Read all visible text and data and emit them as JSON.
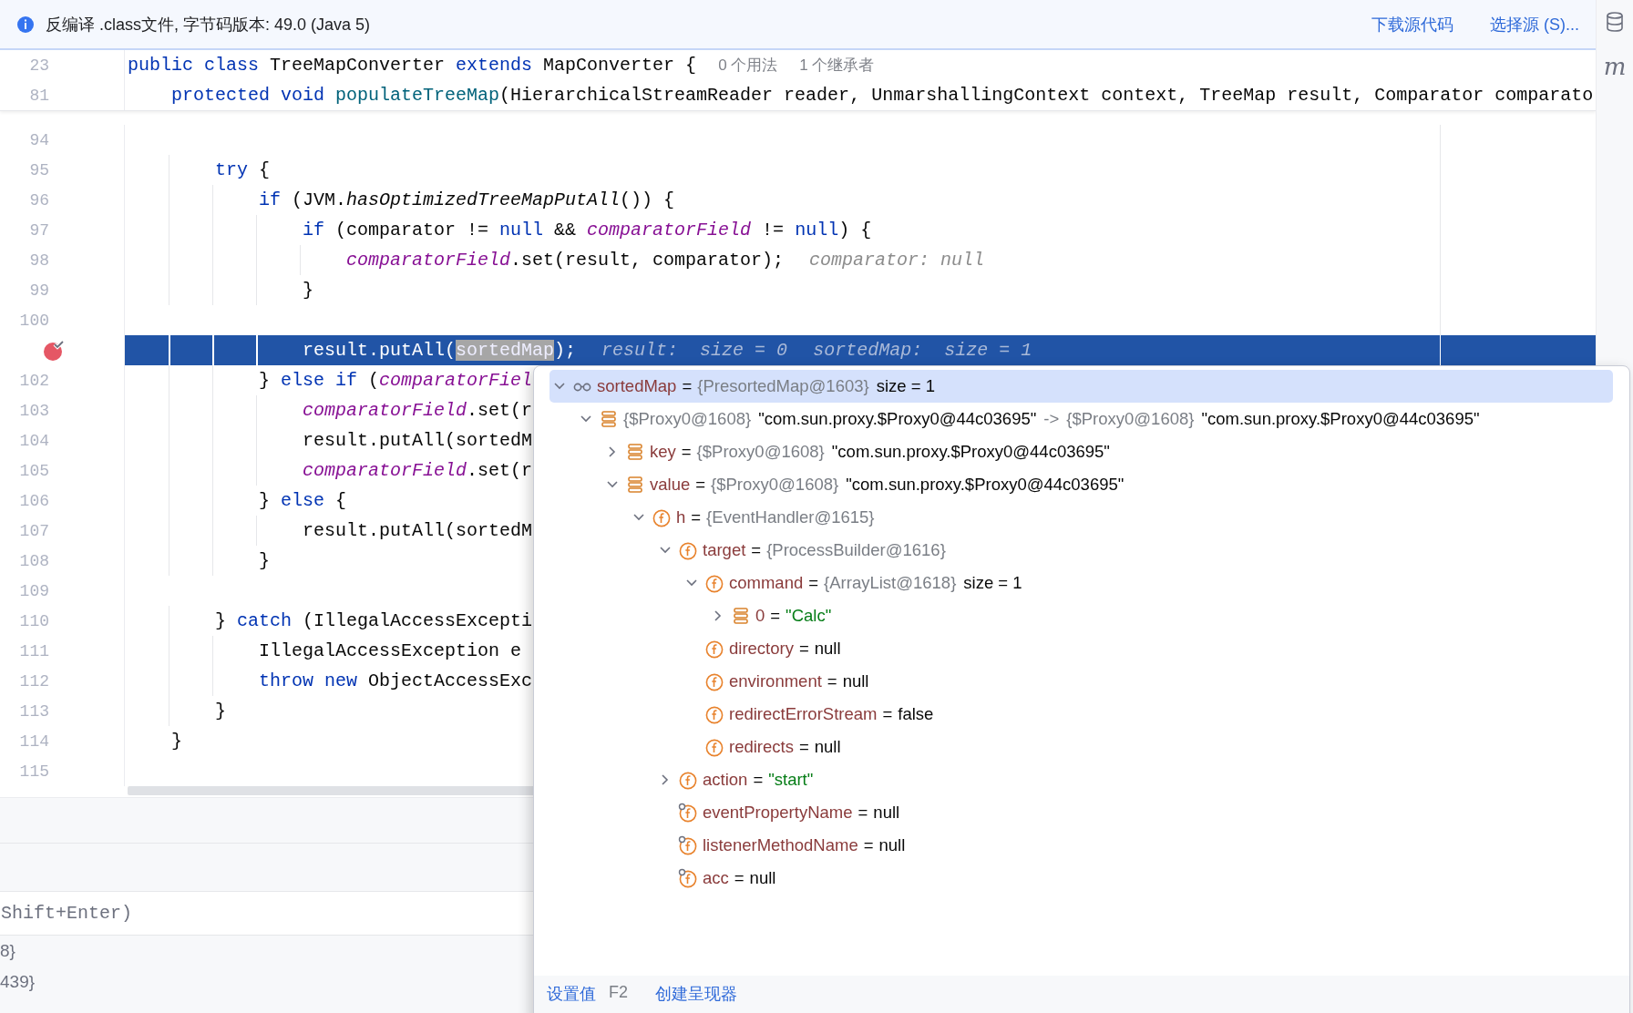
{
  "banner": {
    "message": "反编译 .class文件, 字节码版本: 49.0 (Java 5)",
    "links": [
      "下载源代码",
      "选择源 (S)..."
    ]
  },
  "side_tool_label": "m",
  "sticky_lines": [
    {
      "number": "23",
      "tokens": [
        {
          "kind": "kw",
          "s": "public class"
        },
        {
          "kind": "plain",
          "s": " TreeMapConverter "
        },
        {
          "kind": "kw",
          "s": "extends"
        },
        {
          "kind": "plain",
          "s": " MapConverter {"
        }
      ],
      "annotations": [
        "0 个用法",
        "1 个继承者"
      ]
    },
    {
      "number": "81",
      "tokens": [
        {
          "kind": "kw",
          "s": "    protected void "
        },
        {
          "kind": "decl",
          "s": "populateTreeMap"
        },
        {
          "kind": "plain",
          "s": "(HierarchicalStreamReader reader, UnmarshallingContext context, TreeMap result, Comparator comparato"
        }
      ]
    }
  ],
  "lines": [
    {
      "number": "94",
      "breakpoint": false,
      "current": false
    },
    {
      "number": "95",
      "breakpoint": false,
      "current": false,
      "tokens": [
        {
          "kind": "kw",
          "s": "        try"
        },
        {
          "kind": "plain",
          "s": " {"
        }
      ]
    },
    {
      "number": "96",
      "breakpoint": false,
      "current": false,
      "tokens": [
        {
          "kind": "kw",
          "s": "            if"
        },
        {
          "kind": "plain",
          "s": " (JVM."
        },
        {
          "kind": "static",
          "s": "hasOptimizedTreeMapPutAll"
        },
        {
          "kind": "plain",
          "s": "()) {"
        }
      ]
    },
    {
      "number": "97",
      "breakpoint": false,
      "current": false,
      "tokens": [
        {
          "kind": "kw",
          "s": "                if"
        },
        {
          "kind": "plain",
          "s": " (comparator != "
        },
        {
          "kind": "kw",
          "s": "null"
        },
        {
          "kind": "plain",
          "s": " && "
        },
        {
          "kind": "field",
          "s": "comparatorField"
        },
        {
          "kind": "plain",
          "s": " != "
        },
        {
          "kind": "kw",
          "s": "null"
        },
        {
          "kind": "plain",
          "s": ") {"
        }
      ]
    },
    {
      "number": "98",
      "breakpoint": false,
      "current": false,
      "tokens": [
        {
          "kind": "field",
          "s": "                    comparatorField"
        },
        {
          "kind": "plain",
          "s": ".set(result, comparator);"
        },
        {
          "kind": "hint",
          "s": "comparator: null"
        }
      ]
    },
    {
      "number": "99",
      "breakpoint": false,
      "current": false,
      "tokens": [
        {
          "kind": "plain",
          "s": "                }"
        }
      ]
    },
    {
      "number": "100",
      "breakpoint": false,
      "current": false
    },
    {
      "breakpoint": true,
      "current": true,
      "tokens": [
        {
          "kind": "plain",
          "s": "                result.putAll("
        },
        {
          "kind": "sel",
          "s": "sortedMap"
        },
        {
          "kind": "plain",
          "s": ");"
        },
        {
          "kind": "hint",
          "s": "result:  size = 0"
        },
        {
          "kind": "hint",
          "s": "sortedMap:  size = 1"
        }
      ]
    },
    {
      "number": "102",
      "breakpoint": false,
      "current": false,
      "tokens": [
        {
          "kind": "plain",
          "s": "            } "
        },
        {
          "kind": "kw",
          "s": "else if"
        },
        {
          "kind": "plain",
          "s": " ("
        },
        {
          "kind": "field",
          "s": "comparatorFiel"
        }
      ]
    },
    {
      "number": "103",
      "breakpoint": false,
      "current": false,
      "tokens": [
        {
          "kind": "field",
          "s": "                comparatorField"
        },
        {
          "kind": "plain",
          "s": ".set(r"
        }
      ]
    },
    {
      "number": "104",
      "breakpoint": false,
      "current": false,
      "tokens": [
        {
          "kind": "plain",
          "s": "                result.putAll(sortedM"
        }
      ]
    },
    {
      "number": "105",
      "breakpoint": false,
      "current": false,
      "tokens": [
        {
          "kind": "field",
          "s": "                comparatorField"
        },
        {
          "kind": "plain",
          "s": ".set(r"
        }
      ]
    },
    {
      "number": "106",
      "breakpoint": false,
      "current": false,
      "tokens": [
        {
          "kind": "plain",
          "s": "            } "
        },
        {
          "kind": "kw",
          "s": "else"
        },
        {
          "kind": "plain",
          "s": " {"
        }
      ]
    },
    {
      "number": "107",
      "breakpoint": false,
      "current": false,
      "tokens": [
        {
          "kind": "plain",
          "s": "                result.putAll(sortedM"
        }
      ]
    },
    {
      "number": "108",
      "breakpoint": false,
      "current": false,
      "tokens": [
        {
          "kind": "plain",
          "s": "            }"
        }
      ]
    },
    {
      "number": "109",
      "breakpoint": false,
      "current": false
    },
    {
      "number": "110",
      "breakpoint": false,
      "current": false,
      "tokens": [
        {
          "kind": "plain",
          "s": "        } "
        },
        {
          "kind": "kw",
          "s": "catch"
        },
        {
          "kind": "plain",
          "s": " (IllegalAccessExcepti"
        }
      ]
    },
    {
      "number": "111",
      "breakpoint": false,
      "current": false,
      "tokens": [
        {
          "kind": "plain",
          "s": "            IllegalAccessException e"
        }
      ]
    },
    {
      "number": "112",
      "breakpoint": false,
      "current": false,
      "tokens": [
        {
          "kind": "kw",
          "s": "            throw new"
        },
        {
          "kind": "plain",
          "s": " ObjectAccessExc"
        }
      ]
    },
    {
      "number": "113",
      "breakpoint": false,
      "current": false,
      "tokens": [
        {
          "kind": "plain",
          "s": "        }"
        }
      ]
    },
    {
      "number": "114",
      "breakpoint": false,
      "current": false,
      "tokens": [
        {
          "kind": "plain",
          "s": "    }"
        }
      ]
    },
    {
      "number": "115",
      "breakpoint": false,
      "current": false
    }
  ],
  "expression_field": {
    "placeholder": "Shift+Enter)"
  },
  "variable_fragments": [
    "8}",
    "439}"
  ],
  "popup": {
    "tree": [
      {
        "kind": "watch",
        "expanded": true,
        "selected": true,
        "parts": [
          {
            "kind": "name",
            "s": "sortedMap"
          },
          {
            "kind": "op",
            "s": "="
          },
          {
            "kind": "type",
            "s": "{PresortedMap@1603}"
          },
          {
            "kind": "plain",
            "s": "size = 1"
          }
        ],
        "children": [
          {
            "kind": "entry",
            "expanded": true,
            "selected": false,
            "parts": [
              {
                "kind": "type",
                "s": "{$Proxy0@1608}"
              },
              {
                "kind": "plain",
                "s": "\"com.sun.proxy.$Proxy0@44c03695\""
              },
              {
                "kind": "type",
                "s": "->"
              },
              {
                "kind": "type",
                "s": "{$Proxy0@1608}"
              },
              {
                "kind": "plain",
                "s": "\"com.sun.proxy.$Proxy0@44c03695\""
              }
            ],
            "children": [
              {
                "kind": "entry",
                "expanded": false,
                "selected": false,
                "parts": [
                  {
                    "kind": "name",
                    "s": "key"
                  },
                  {
                    "kind": "op",
                    "s": "="
                  },
                  {
                    "kind": "type",
                    "s": "{$Proxy0@1608}"
                  },
                  {
                    "kind": "plain",
                    "s": "\"com.sun.proxy.$Proxy0@44c03695\""
                  }
                ]
              },
              {
                "kind": "entry",
                "expanded": true,
                "selected": false,
                "parts": [
                  {
                    "kind": "name",
                    "s": "value"
                  },
                  {
                    "kind": "op",
                    "s": "="
                  },
                  {
                    "kind": "type",
                    "s": "{$Proxy0@1608}"
                  },
                  {
                    "kind": "plain",
                    "s": "\"com.sun.proxy.$Proxy0@44c03695\""
                  }
                ],
                "children": [
                  {
                    "kind": "field",
                    "expanded": true,
                    "selected": false,
                    "parts": [
                      {
                        "kind": "name",
                        "s": "h"
                      },
                      {
                        "kind": "op",
                        "s": "="
                      },
                      {
                        "kind": "type",
                        "s": "{EventHandler@1615}"
                      }
                    ],
                    "children": [
                      {
                        "kind": "field",
                        "expanded": true,
                        "selected": false,
                        "parts": [
                          {
                            "kind": "name",
                            "s": "target"
                          },
                          {
                            "kind": "op",
                            "s": "="
                          },
                          {
                            "kind": "type",
                            "s": "{ProcessBuilder@1616}"
                          }
                        ],
                        "children": [
                          {
                            "kind": "field",
                            "expanded": true,
                            "selected": false,
                            "parts": [
                              {
                                "kind": "name",
                                "s": "command"
                              },
                              {
                                "kind": "op",
                                "s": "="
                              },
                              {
                                "kind": "type",
                                "s": "{ArrayList@1618}"
                              },
                              {
                                "kind": "plain",
                                "s": "size = 1"
                              }
                            ],
                            "children": [
                              {
                                "kind": "entry",
                                "expanded": false,
                                "selected": false,
                                "parts": [
                                  {
                                    "kind": "name",
                                    "s": "0"
                                  },
                                  {
                                    "kind": "op",
                                    "s": "="
                                  },
                                  {
                                    "kind": "string",
                                    "s": "\"Calc\""
                                  }
                                ]
                              }
                            ]
                          },
                          {
                            "kind": "field",
                            "selected": false,
                            "parts": [
                              {
                                "kind": "name",
                                "s": "directory"
                              },
                              {
                                "kind": "op",
                                "s": "="
                              },
                              {
                                "kind": "plain",
                                "s": "null"
                              }
                            ]
                          },
                          {
                            "kind": "field",
                            "selected": false,
                            "parts": [
                              {
                                "kind": "name",
                                "s": "environment"
                              },
                              {
                                "kind": "op",
                                "s": "="
                              },
                              {
                                "kind": "plain",
                                "s": "null"
                              }
                            ]
                          },
                          {
                            "kind": "field",
                            "selected": false,
                            "parts": [
                              {
                                "kind": "name",
                                "s": "redirectErrorStream"
                              },
                              {
                                "kind": "op",
                                "s": "="
                              },
                              {
                                "kind": "plain",
                                "s": "false"
                              }
                            ]
                          },
                          {
                            "kind": "field",
                            "selected": false,
                            "parts": [
                              {
                                "kind": "name",
                                "s": "redirects"
                              },
                              {
                                "kind": "op",
                                "s": "="
                              },
                              {
                                "kind": "plain",
                                "s": "null"
                              }
                            ]
                          }
                        ]
                      },
                      {
                        "kind": "field",
                        "expanded": false,
                        "selected": false,
                        "parts": [
                          {
                            "kind": "name",
                            "s": "action"
                          },
                          {
                            "kind": "op",
                            "s": "="
                          },
                          {
                            "kind": "string",
                            "s": "\"start\""
                          }
                        ]
                      },
                      {
                        "kind": "marked_field",
                        "selected": false,
                        "parts": [
                          {
                            "kind": "name",
                            "s": "eventPropertyName"
                          },
                          {
                            "kind": "op",
                            "s": "="
                          },
                          {
                            "kind": "plain",
                            "s": "null"
                          }
                        ]
                      },
                      {
                        "kind": "marked_field",
                        "selected": false,
                        "parts": [
                          {
                            "kind": "name",
                            "s": "listenerMethodName"
                          },
                          {
                            "kind": "op",
                            "s": "="
                          },
                          {
                            "kind": "plain",
                            "s": "null"
                          }
                        ]
                      },
                      {
                        "kind": "marked_field",
                        "selected": false,
                        "parts": [
                          {
                            "kind": "name",
                            "s": "acc"
                          },
                          {
                            "kind": "op",
                            "s": "="
                          },
                          {
                            "kind": "plain",
                            "s": "null"
                          }
                        ]
                      }
                    ]
                  }
                ]
              }
            ]
          }
        ]
      }
    ],
    "footer": [
      {
        "label": "设置值",
        "shortcut": "F2"
      },
      {
        "label": "创建呈现器"
      }
    ]
  }
}
